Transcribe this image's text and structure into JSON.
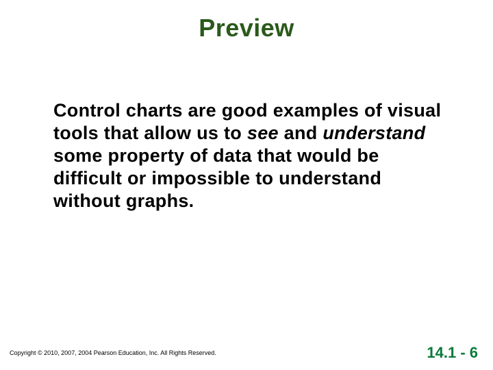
{
  "title": "Preview",
  "body": {
    "part1": "Control charts are good examples of visual tools that allow us to ",
    "italic1": "see",
    "part2": " and ",
    "italic2": "understand",
    "part3": " some property of data that would be difficult or impossible to understand without graphs."
  },
  "copyright": "Copyright © 2010, 2007, 2004 Pearson Education, Inc. All Rights Reserved.",
  "pagenum": "14.1 - 6"
}
